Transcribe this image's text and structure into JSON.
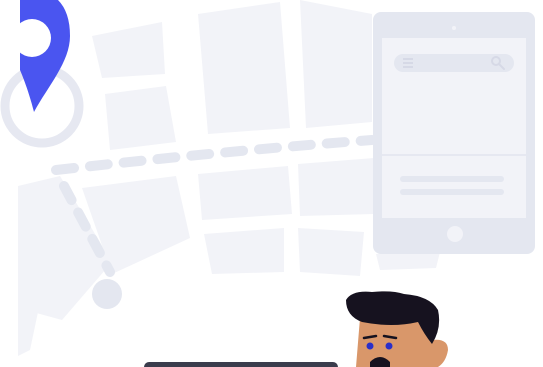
{
  "illustration": {
    "subject": "map-route-to-phone",
    "colors": {
      "background": "#ffffff",
      "map_block": "#f2f3f8",
      "map_mid": "#e6e8f1",
      "route_dash": "#e4e7f0",
      "pin": "#4a55f0",
      "pin_hole": "#ffffff",
      "phone_body": "#e4e7f0",
      "phone_screen": "#f2f3f8",
      "phone_line": "#e4e7f0",
      "phone_icon": "#d6d9e6",
      "person_hair": "#16121f",
      "person_skin": "#d9976a",
      "person_eye": "#2b2fc8",
      "laptop": "#3a3c4c"
    },
    "icons": [
      "map-pin-icon",
      "menu-icon",
      "search-icon"
    ]
  }
}
